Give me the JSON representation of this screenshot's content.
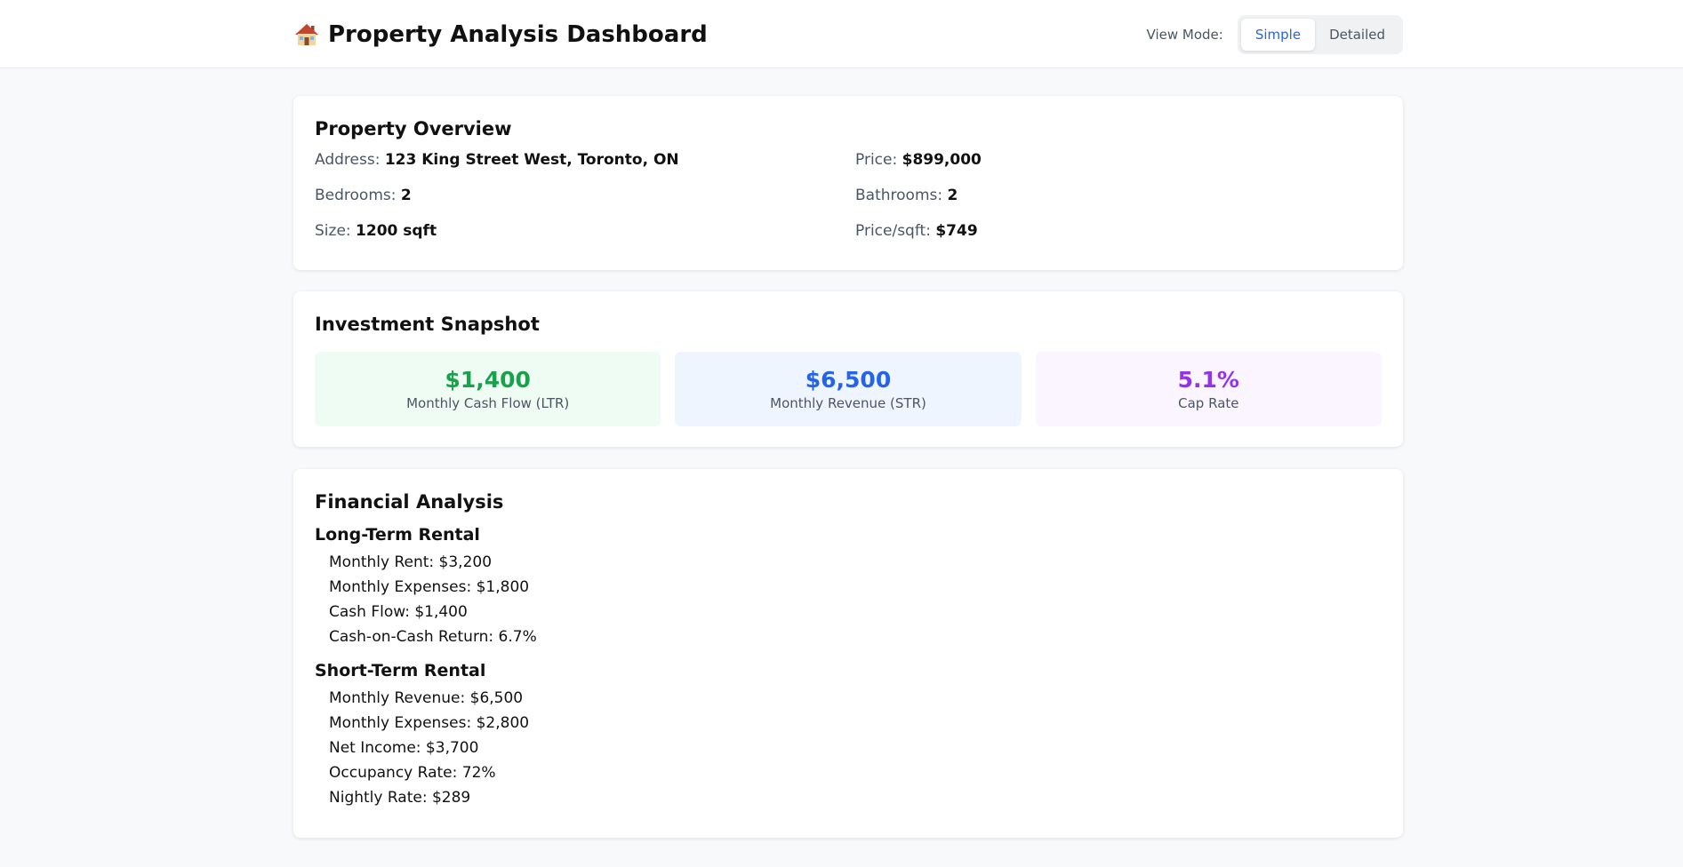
{
  "header": {
    "title": "Property Analysis Dashboard",
    "icon": "house-icon",
    "view_mode_label": "View Mode:",
    "view_modes": [
      "Simple",
      "Detailed"
    ],
    "active_view_mode": "Simple"
  },
  "overview": {
    "title": "Property Overview",
    "fields": [
      {
        "label": "Address:",
        "value": "123 King Street West, Toronto, ON"
      },
      {
        "label": "Price:",
        "value": "$899,000"
      },
      {
        "label": "Bedrooms:",
        "value": "2"
      },
      {
        "label": "Bathrooms:",
        "value": "2"
      },
      {
        "label": "Size:",
        "value": "1200 sqft"
      },
      {
        "label": "Price/sqft:",
        "value": "$749"
      }
    ]
  },
  "snapshot": {
    "title": "Investment Snapshot",
    "metrics": [
      {
        "value": "$1,400",
        "label": "Monthly Cash Flow (LTR)",
        "color": "#16a34a",
        "bg": "#effcf3"
      },
      {
        "value": "$6,500",
        "label": "Monthly Revenue (STR)",
        "color": "#2563eb",
        "bg": "#eef5ff"
      },
      {
        "value": "5.1%",
        "label": "Cap Rate",
        "color": "#9333ea",
        "bg": "#faf5ff"
      }
    ]
  },
  "financial": {
    "title": "Financial Analysis",
    "long_term": {
      "title": "Long-Term Rental",
      "items": [
        "Monthly Rent: $3,200",
        "Monthly Expenses: $1,800",
        "Cash Flow: $1,400",
        "Cash-on-Cash Return: 6.7%"
      ]
    },
    "short_term": {
      "title": "Short-Term Rental",
      "items": [
        "Monthly Revenue: $6,500",
        "Monthly Expenses: $2,800",
        "Net Income: $3,700",
        "Occupancy Rate: 72%",
        "Nightly Rate: $289"
      ]
    }
  }
}
